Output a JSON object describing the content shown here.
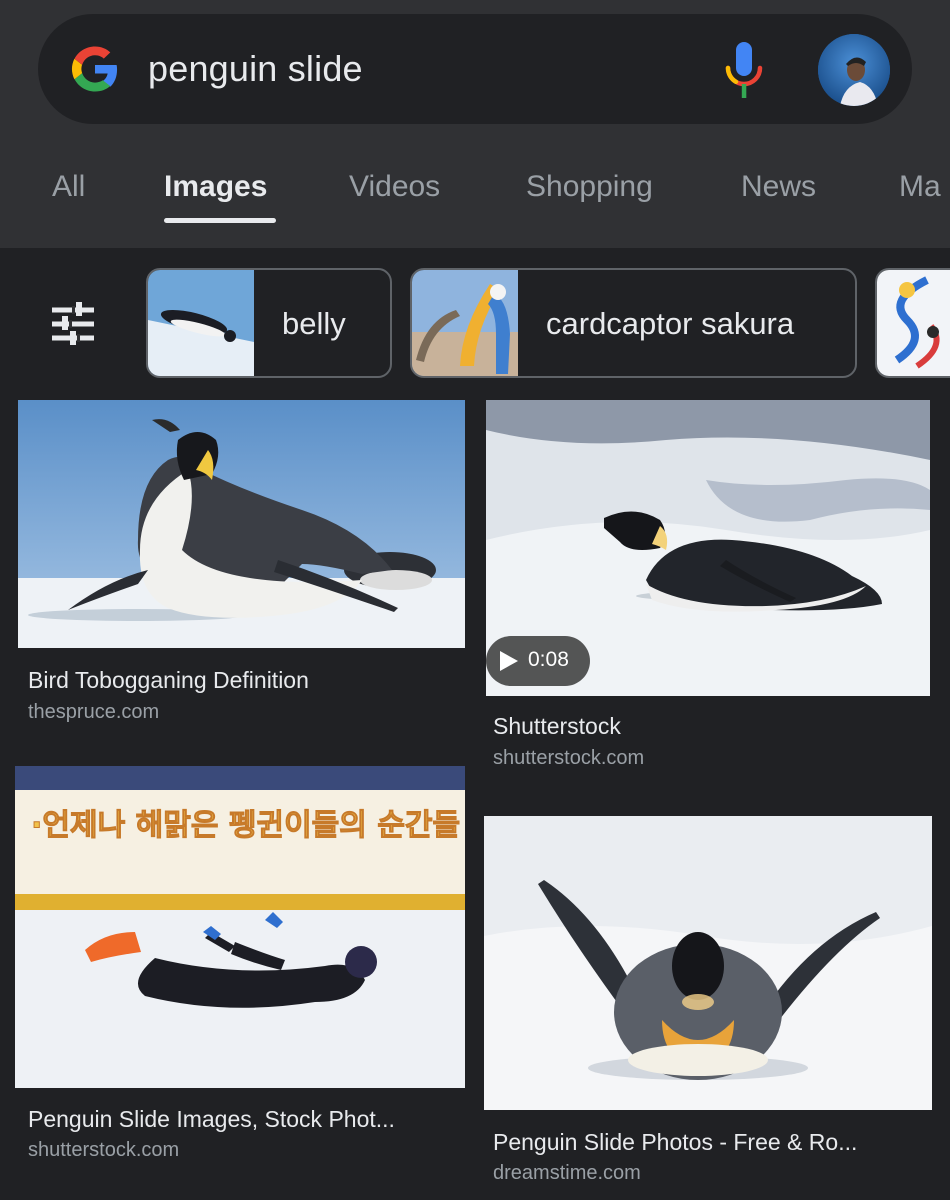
{
  "search": {
    "query": "penguin slide"
  },
  "tabs": [
    {
      "label": "All"
    },
    {
      "label": "Images",
      "active": true
    },
    {
      "label": "Videos"
    },
    {
      "label": "Shopping"
    },
    {
      "label": "News"
    },
    {
      "label": "Ma"
    }
  ],
  "chips": [
    {
      "label": "belly"
    },
    {
      "label": "cardcaptor sakura"
    }
  ],
  "results": [
    {
      "title": "Bird Tobogganing Definition",
      "source": "thespruce.com"
    },
    {
      "title": "Shutterstock",
      "source": "shutterstock.com",
      "duration": "0:08"
    },
    {
      "title": "Penguin Slide Images, Stock Phot...",
      "source": "shutterstock.com",
      "overlay_text": "·언제나 해맑은 펭귄이들의 순간들"
    },
    {
      "title": "Penguin Slide Photos - Free & Ro...",
      "source": "dreamstime.com"
    }
  ],
  "colors": {
    "background": "#202124",
    "header": "#303134",
    "text_primary": "#e8eaed",
    "text_secondary": "#9aa0a6",
    "chip_border": "#5f6368"
  },
  "icons": [
    "google-logo-icon",
    "mic-icon",
    "avatar",
    "tune-icon",
    "play-icon"
  ]
}
